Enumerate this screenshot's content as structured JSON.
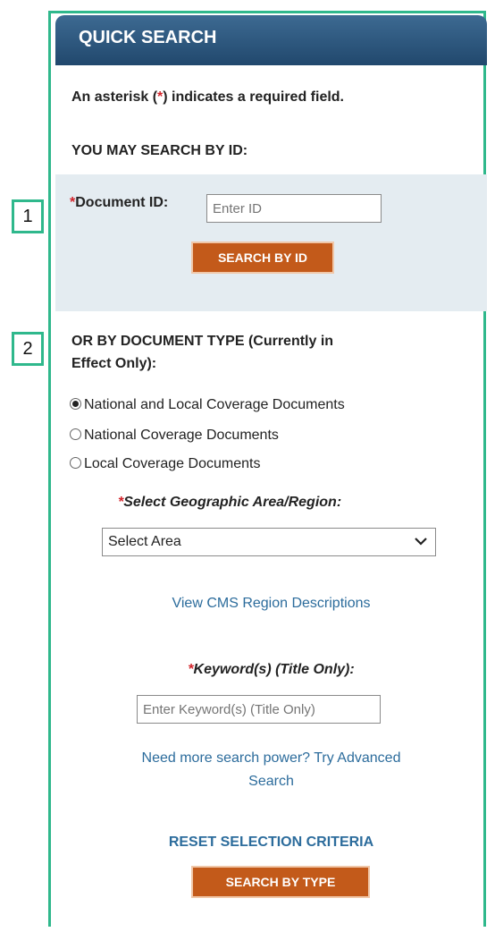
{
  "header": {
    "title": "QUICK SEARCH"
  },
  "intro": {
    "asterisk_pre": "An asterisk (",
    "asterisk_mark": "*",
    "asterisk_post": ") indicates a required field.",
    "search_by_id_heading": "YOU MAY SEARCH BY ID:"
  },
  "callouts": [
    "1",
    "2"
  ],
  "id_search": {
    "required_mark": "*",
    "label": "Document ID:",
    "placeholder": "Enter ID",
    "button_label": "SEARCH BY ID"
  },
  "type_search": {
    "heading_line1": "OR BY DOCUMENT TYPE (Currently in",
    "heading_line2": "Effect Only):",
    "options": [
      {
        "label": "National and Local Coverage Documents",
        "selected": true
      },
      {
        "label": "National Coverage Documents",
        "selected": false
      },
      {
        "label": "Local Coverage Documents",
        "selected": false
      }
    ],
    "region_required_mark": "*",
    "region_label": "Select Geographic Area/Region:",
    "region_selected": "Select Area",
    "region_link": "View CMS Region Descriptions",
    "keyword_required_mark": "*",
    "keyword_label": "Keyword(s) (Title Only):",
    "keyword_placeholder": "Enter Keyword(s) (Title Only)",
    "advanced_link_line1": "Need more search power? Try Advanced",
    "advanced_link_line2": "Search",
    "reset_label": "RESET SELECTION CRITERIA",
    "search_button_label": "SEARCH BY TYPE"
  },
  "colors": {
    "accent": "#2fb88c",
    "header": "#2c5680",
    "button": "#c35a1a",
    "link": "#2c6c9c",
    "required": "#d2232a"
  }
}
